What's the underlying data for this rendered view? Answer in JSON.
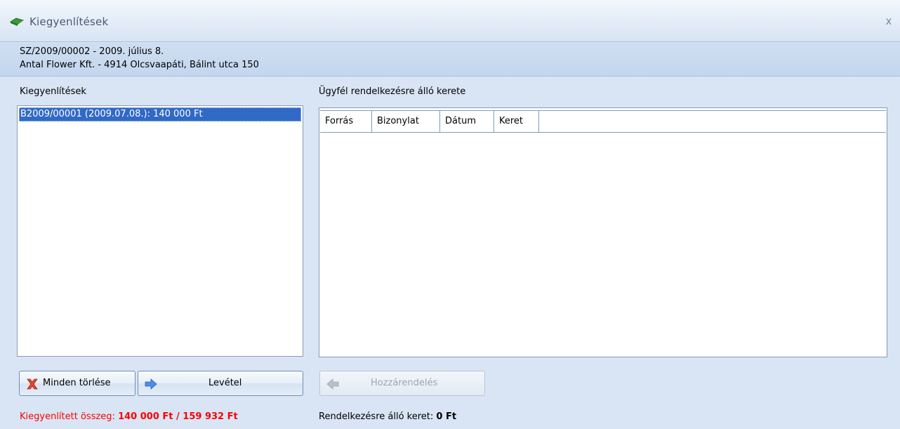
{
  "window": {
    "title": "Kiegyenlítések",
    "close_symbol": "x",
    "icon": "book-icon"
  },
  "info": {
    "line1": "SZ/2009/00002 - 2009. július 8.",
    "line2": "Antal Flower Kft. - 4914 Olcsvaapáti, Bálint utca 150"
  },
  "left_panel": {
    "label": "Kiegyenlítések",
    "items": [
      "B2009/00001 (2009.07.08.): 140 000 Ft"
    ]
  },
  "right_panel": {
    "label": "Ügyfél rendelkezésre álló kerete",
    "columns": [
      "Forrás",
      "Bizonylat",
      "Dátum",
      "Keret"
    ],
    "rows": []
  },
  "buttons": {
    "clear_all": "Minden törlése",
    "remove": "Levétel",
    "assign": "Hozzárendelés"
  },
  "status": {
    "settled_label": "Kiegyenlített összeg:",
    "settled_value": "140 000 Ft / 159 932 Ft",
    "available_label": "Rendelkezésre álló keret:",
    "available_value": "0 Ft"
  },
  "colors": {
    "selection": "#3169c6",
    "status_red": "#ff0000"
  }
}
